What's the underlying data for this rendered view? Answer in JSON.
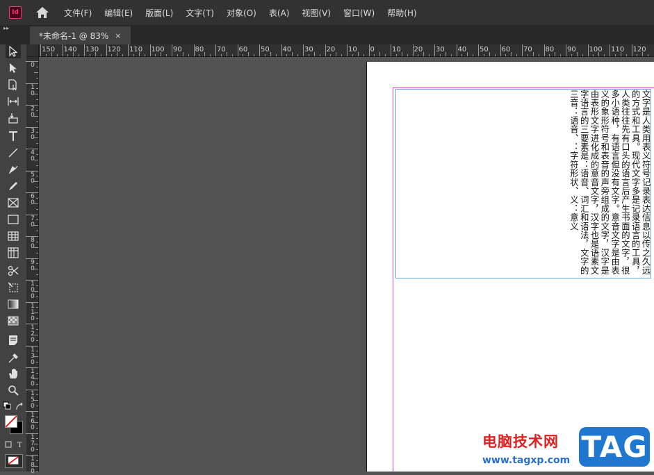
{
  "app": {
    "logo_text": "Id"
  },
  "menu": [
    "文件(F)",
    "编辑(E)",
    "版面(L)",
    "文字(T)",
    "对象(O)",
    "表(A)",
    "视图(V)",
    "窗口(W)",
    "帮助(H)"
  ],
  "tabbar": {
    "collapse_glyph": "▸▸"
  },
  "document_tab": {
    "title": "*未命名-1 @ 83%",
    "close_glyph": "×"
  },
  "ruler_top": [
    "150",
    "140",
    "130",
    "120",
    "110",
    "100",
    "90",
    "80",
    "70",
    "60",
    "50",
    "40",
    "30",
    "20",
    "10",
    "0",
    "10",
    "20",
    "30",
    "40",
    "50",
    "60",
    "70",
    "80",
    "90",
    "100",
    "110",
    "120"
  ],
  "ruler_left": [
    "0",
    "10",
    "20",
    "30",
    "40",
    "50",
    "60",
    "70",
    "80",
    "90",
    "100",
    "110",
    "120",
    "130",
    "140",
    "150",
    "160",
    "170",
    "180"
  ],
  "tools": [
    "selection-tool-icon",
    "direct-selection-tool-icon",
    "page-tool-icon",
    "gap-tool-icon",
    "content-collector-icon",
    "type-tool-icon",
    "line-tool-icon",
    "pen-tool-icon",
    "pencil-tool-icon",
    "rectangle-frame-tool-icon",
    "rectangle-tool-icon",
    "table-tool-icon",
    "grid-table-tool-icon",
    "scissors-tool-icon",
    "free-transform-tool-icon",
    "gradient-swatch-tool-icon",
    "gradient-feather-tool-icon",
    "note-tool-icon",
    "eyedropper-tool-icon",
    "hand-tool-icon",
    "zoom-tool-icon"
  ],
  "body_text": "文字是人类用表义符号记录表达信息以传之久远的方式和工具。现代文字多是记录语言的工具，人类往往先有口头的语言后产生书面的文字，很多小语种，有语言但没有文字。意音文字是由表义的象形符号和表音的声旁组成的文字，汉字是由表形文字进化成的意音文字，汉字也是语素文字语言的三要素是：语音、词汇和语法，文字的三音：语音、：字符形状、义：意义",
  "watermark": {
    "text": "电脑技术网",
    "url": "www.tagxp.com",
    "badge": "TAG"
  },
  "colors": {
    "menubar": "#323232",
    "tabbar": "#282828",
    "toolbar": "#424242",
    "pasteboard": "#535353",
    "margin_guide": "#c64bc6",
    "frame_border": "#6fa8dc"
  }
}
